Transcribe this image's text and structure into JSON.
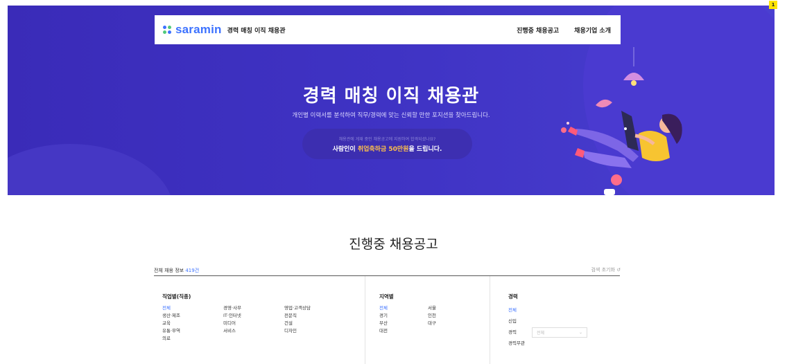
{
  "header": {
    "logo_text": "saramin",
    "service_title": "경력 매칭 이직 채용관",
    "nav": [
      "진행중 채용공고",
      "채용기업 소개"
    ]
  },
  "hero": {
    "title": "경력 매칭 이직 채용관",
    "subtitle": "개인별 이력서를 분석하여 직무/경력에 맞는 신뢰할 만한 포지션을 찾아드립니다.",
    "promo_small": "채용관에 게재 중인 채용공고에 지원하여 합격되셨나요?",
    "promo_prefix": "사람인이 ",
    "promo_highlight": "취업축하금 50만원",
    "promo_suffix": "을 드립니다."
  },
  "section": {
    "title": "진행중 채용공고",
    "summary_prefix": "전체 채용 정보 ",
    "summary_count": "419건",
    "reset_label": "검색 초기화 ↺"
  },
  "filters": {
    "job": {
      "heading": "직업별(직종)",
      "options": [
        "전체",
        "경영·사무",
        "영업·고객상담",
        "생산·제조",
        "IT·인터넷",
        "전문직",
        "교육",
        "미디어",
        "건설",
        "유통·무역",
        "서비스",
        "디자인",
        "의료"
      ]
    },
    "region": {
      "heading": "지역별",
      "options": [
        "전체",
        "서울",
        "경기",
        "인천",
        "부산",
        "대구",
        "대전"
      ]
    },
    "career": {
      "heading": "경력",
      "options": [
        "전체",
        "신입",
        "경력",
        "경력무관"
      ],
      "select_value": "전체"
    }
  },
  "badge": "1",
  "colors": {
    "hero_bg": "#3f33c4",
    "accent": "#3d72ff",
    "highlight": "#ffc14a"
  }
}
